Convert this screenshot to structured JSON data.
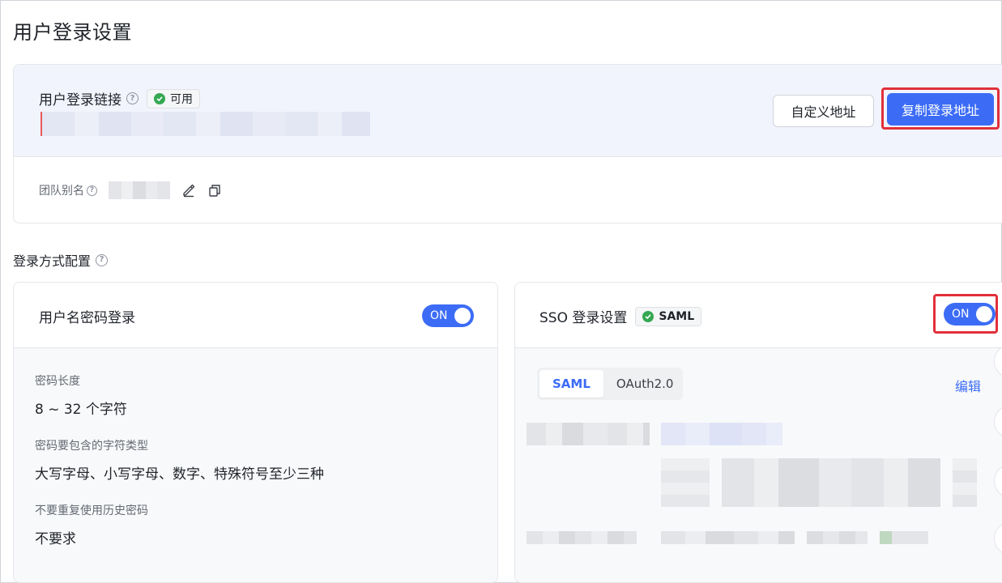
{
  "page": {
    "title": "用户登录设置"
  },
  "link_card": {
    "title": "用户登录链接",
    "status_tag": "可用",
    "custom_button": "自定义地址",
    "copy_button": "复制登录地址",
    "alias_label": "团队别名"
  },
  "login_config": {
    "title": "登录方式配置"
  },
  "password_card": {
    "title": "用户名密码登录",
    "toggle": "ON",
    "fields": [
      {
        "label": "密码长度",
        "value": "8 ~ 32 个字符"
      },
      {
        "label": "密码要包含的字符类型",
        "value": "大写字母、小写字母、数字、特殊符号至少三种"
      },
      {
        "label": "不要重复使用历史密码",
        "value": "不要求"
      }
    ]
  },
  "sso_card": {
    "title": "SSO 登录设置",
    "tag": "SAML",
    "toggle": "ON",
    "tabs": [
      "SAML",
      "OAuth2.0"
    ],
    "edit_link": "编辑"
  },
  "colors": {
    "primary": "#3c6cf6",
    "success": "#34a853",
    "highlight": "#e1303a"
  }
}
